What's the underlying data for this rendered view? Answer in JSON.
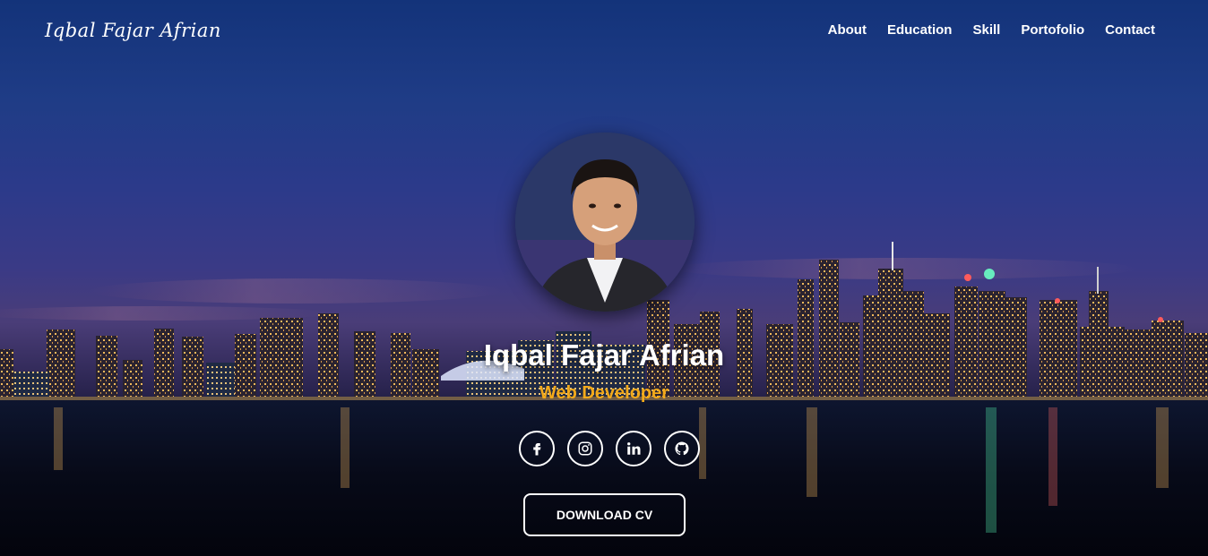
{
  "brand": {
    "logo_text": "Iqbal Fajar Afrian"
  },
  "nav": {
    "items": [
      {
        "label": "About"
      },
      {
        "label": "Education"
      },
      {
        "label": "Skill"
      },
      {
        "label": "Portofolio"
      },
      {
        "label": "Contact"
      }
    ]
  },
  "hero": {
    "name": "Iqbal Fajar Afrian",
    "role": "Web Developer",
    "cta_label": "DOWNLOAD CV"
  },
  "socials": [
    {
      "icon": "facebook-icon"
    },
    {
      "icon": "instagram-icon"
    },
    {
      "icon": "linkedin-icon"
    },
    {
      "icon": "github-icon"
    }
  ],
  "colors": {
    "accent": "#f2a91a",
    "text": "#ffffff"
  }
}
